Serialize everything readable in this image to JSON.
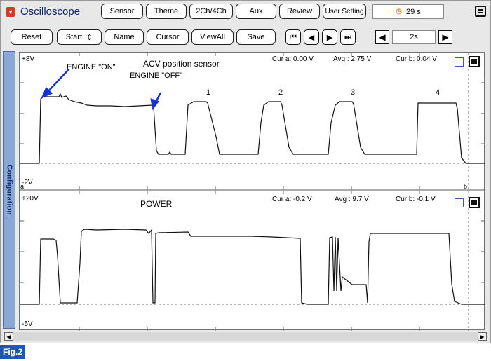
{
  "toolbar": {
    "title": "Oscilloscope",
    "sensor": "Sensor",
    "theme": "Theme",
    "channels": "2Ch/4Ch",
    "aux": "Aux",
    "review": "Review",
    "user_setting": "User Setting",
    "timer": "29 s",
    "timer_icon": "clock-icon"
  },
  "controls": {
    "reset": "Reset",
    "start": "Start",
    "start_arrows": "⇕",
    "name": "Name",
    "cursor": "Cursor",
    "viewall": "ViewAll",
    "save": "Save",
    "timebase": "2s"
  },
  "sidebar": {
    "tab": "Configuration"
  },
  "channel1": {
    "top_label": "+8V",
    "bottom_label": "-2V",
    "cursor_a_marker": "a",
    "cursor_b_marker": "b",
    "name": "ACV position sensor",
    "cur_a": "Cur a: 0.00 V",
    "avg": "Avg : 2.75 V",
    "cur_b": "Cur b: 0.04 V",
    "annotations": {
      "engine_on": "ENGINE \"ON\"",
      "engine_off": "ENGINE \"OFF\"",
      "p1": "1",
      "p2": "2",
      "p3": "3",
      "p4": "4"
    },
    "arrow_color": "#1633d8"
  },
  "channel2": {
    "top_label": "+20V",
    "bottom_label": "-5V",
    "name": "POWER",
    "cur_a": "Cur a: -0.2 V",
    "avg": "Avg : 9.7 V",
    "cur_b": "Cur b: -0.1 V"
  },
  "figure": {
    "label": "Fig.2"
  },
  "colors": {
    "accent": "#1e57b4",
    "side_tab": "#8aa7d6",
    "close_red": "#d23b2a"
  }
}
